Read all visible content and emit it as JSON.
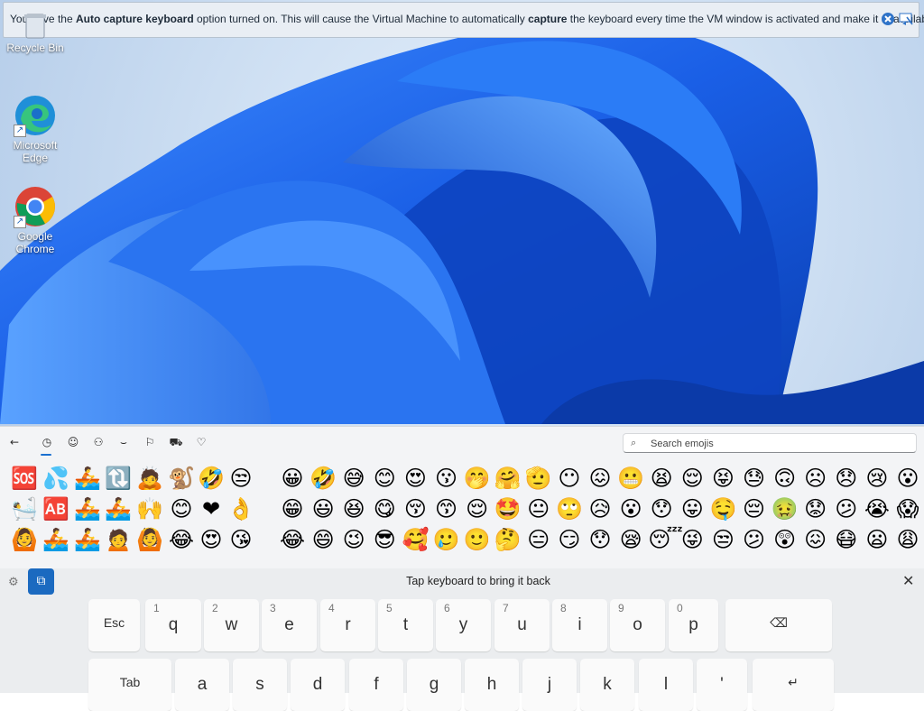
{
  "vm_notification": {
    "prefix": "You have the ",
    "bold1": "Auto capture keyboard",
    "middle": " option turned on. This will cause the Virtual Machine to automatically ",
    "bold2": "capture",
    "suffix": " the keyboard every time the VM window is activated and make it unavailable to",
    "close_icon": "close-icon",
    "dismiss_icon": "do-not-show-again-icon"
  },
  "desktop": {
    "icons": [
      {
        "label": "Recycle Bin",
        "icon": "recycle-bin-icon"
      },
      {
        "label": "Microsoft Edge",
        "icon": "edge-icon"
      },
      {
        "label": "Google Chrome",
        "icon": "chrome-icon"
      }
    ],
    "accent": "#1a66e0"
  },
  "emoji_panel": {
    "tabs": [
      {
        "name": "back",
        "icon": "←"
      },
      {
        "name": "recently-used",
        "icon": "◷"
      },
      {
        "name": "smileys",
        "icon": "☺"
      },
      {
        "name": "people",
        "icon": "⚇"
      },
      {
        "name": "celebrations",
        "icon": "⌣"
      },
      {
        "name": "flags",
        "icon": "⚐"
      },
      {
        "name": "transport",
        "icon": "⛟"
      },
      {
        "name": "hearts",
        "icon": "♡"
      }
    ],
    "search_placeholder": "Search emojis",
    "recent_rows": [
      [
        "🆘",
        "💦",
        "🚣",
        "🔃",
        "🙇",
        "🐒",
        "🤣",
        "😒"
      ],
      [
        "🛀",
        "🆎",
        "🚣",
        "🚣",
        "🙌",
        "😊",
        "❤",
        "👌"
      ],
      [
        "🙆",
        "🚣",
        "🚣",
        "🙍",
        "🙆",
        "😂",
        "😍",
        "😘"
      ]
    ],
    "smiley_rows": [
      [
        "😀",
        "🤣",
        "😅",
        "😊",
        "😍",
        "😗",
        "🤭",
        "🤗",
        "🫡",
        "😶",
        "😖",
        "😬",
        "😫",
        "😌",
        "😝",
        "😓",
        "🙃",
        "☹",
        "😞",
        "😢",
        "😮"
      ],
      [
        "😁",
        "😃",
        "😆",
        "😋",
        "😚",
        "😙",
        "😌",
        "🤩",
        "😐",
        "🙄",
        "😥",
        "😮",
        "😯",
        "😛",
        "🤤",
        "😔",
        "🤢",
        "😟",
        "😕",
        "😭",
        "😱"
      ],
      [
        "😂",
        "😄",
        "😉",
        "😎",
        "🥰",
        "🥲",
        "🙂",
        "🤔",
        "😑",
        "😏",
        "😯",
        "😪",
        "😴",
        "😜",
        "😒",
        "😕",
        "😲",
        "😖",
        "😷",
        "😦",
        "😩"
      ]
    ]
  },
  "keyboard": {
    "status_message": "Tap keyboard to bring it back",
    "close_icon": "close-icon",
    "settings_icon": "gear-icon",
    "dock_icon": "dock-keyboard-icon",
    "row1": [
      {
        "label": "Esc",
        "num": ""
      },
      {
        "label": "q",
        "num": "1"
      },
      {
        "label": "w",
        "num": "2"
      },
      {
        "label": "e",
        "num": "3"
      },
      {
        "label": "r",
        "num": "4"
      },
      {
        "label": "t",
        "num": "5"
      },
      {
        "label": "y",
        "num": "6"
      },
      {
        "label": "u",
        "num": "7"
      },
      {
        "label": "i",
        "num": "8"
      },
      {
        "label": "o",
        "num": "9"
      },
      {
        "label": "p",
        "num": "0"
      },
      {
        "label": "",
        "num": ""
      },
      {
        "label": "⌫",
        "num": ""
      }
    ],
    "row2": [
      {
        "label": "Tab",
        "num": ""
      },
      {
        "label": "a",
        "num": ""
      },
      {
        "label": "s",
        "num": ""
      },
      {
        "label": "d",
        "num": ""
      },
      {
        "label": "f",
        "num": ""
      },
      {
        "label": "g",
        "num": ""
      },
      {
        "label": "h",
        "num": ""
      },
      {
        "label": "j",
        "num": ""
      },
      {
        "label": "k",
        "num": ""
      },
      {
        "label": "l",
        "num": ""
      },
      {
        "label": "'",
        "num": ""
      },
      {
        "label": "↵",
        "num": ""
      }
    ]
  }
}
